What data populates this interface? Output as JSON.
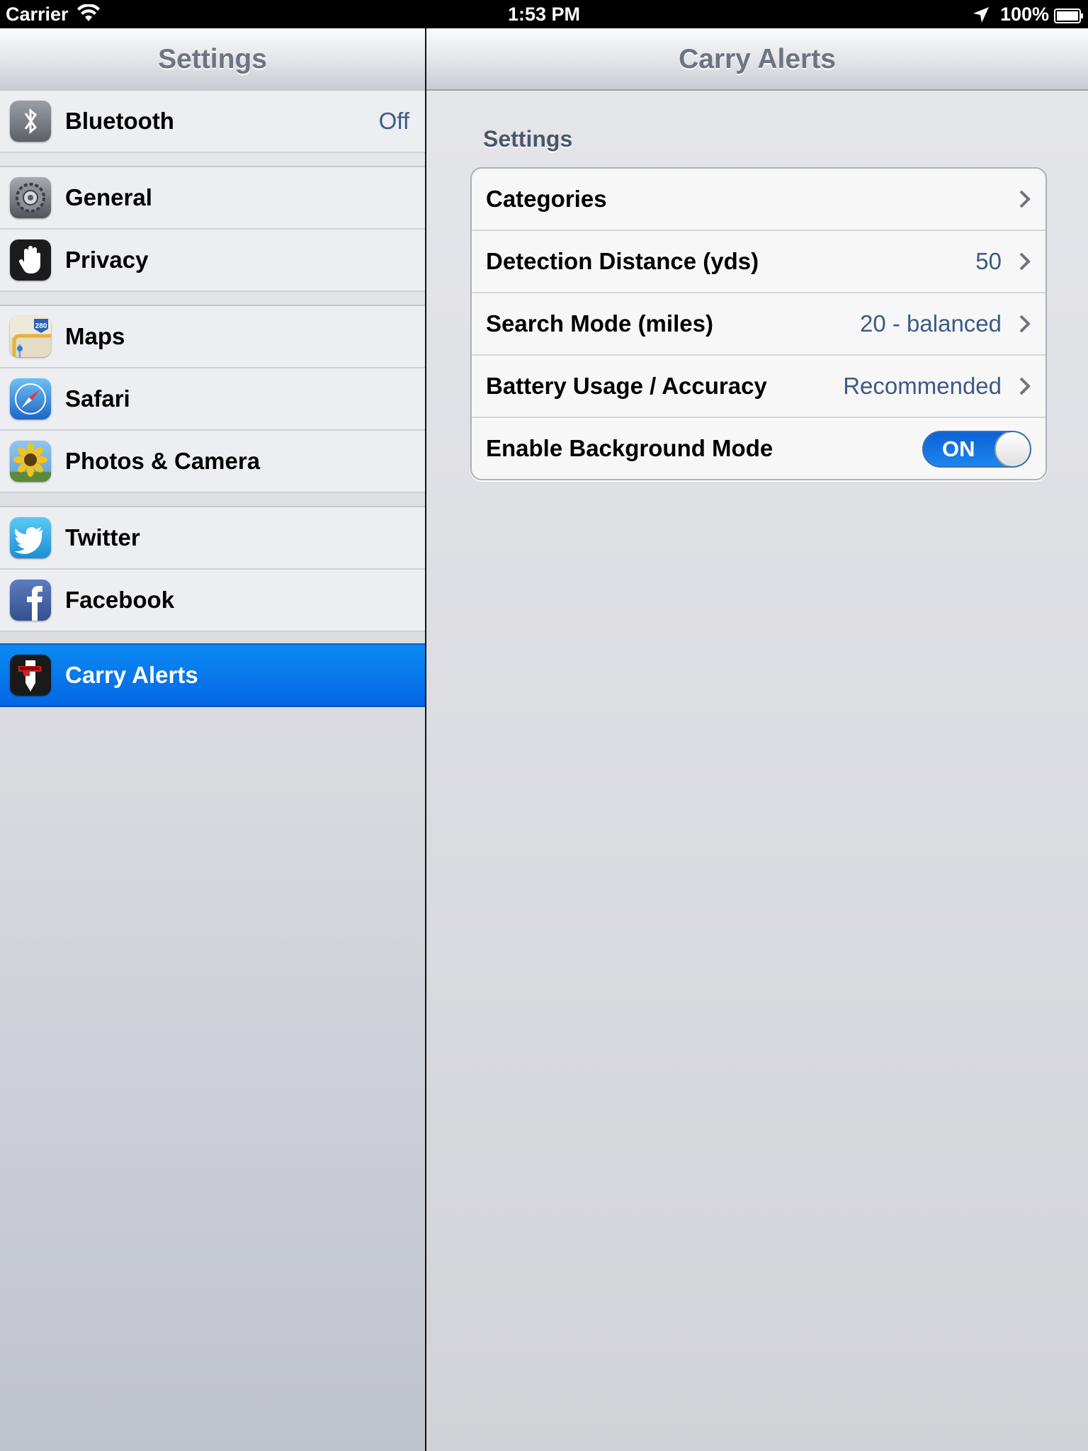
{
  "status_bar": {
    "carrier": "Carrier",
    "time": "1:53 PM",
    "battery": "100%"
  },
  "master": {
    "title": "Settings",
    "groups": [
      [
        {
          "label": "Bluetooth",
          "value": "Off",
          "icon": "bluetooth-icon"
        }
      ],
      [
        {
          "label": "General",
          "icon": "gear-icon"
        },
        {
          "label": "Privacy",
          "icon": "hand-icon"
        }
      ],
      [
        {
          "label": "Maps",
          "icon": "maps-icon"
        },
        {
          "label": "Safari",
          "icon": "compass-icon"
        },
        {
          "label": "Photos & Camera",
          "icon": "sunflower-icon"
        }
      ],
      [
        {
          "label": "Twitter",
          "icon": "twitter-bird-icon"
        },
        {
          "label": "Facebook",
          "icon": "facebook-icon"
        }
      ],
      [
        {
          "label": "Carry Alerts",
          "icon": "carry-alerts-icon",
          "selected": true
        }
      ]
    ]
  },
  "detail": {
    "title": "Carry Alerts",
    "section_header": "Settings",
    "cells": [
      {
        "label": "Categories",
        "value": ""
      },
      {
        "label": "Detection Distance (yds)",
        "value": "50"
      },
      {
        "label": "Search Mode (miles)",
        "value": "20 - balanced"
      },
      {
        "label": "Battery Usage / Accuracy",
        "value": "Recommended"
      },
      {
        "label": "Enable Background Mode",
        "toggle": "ON"
      }
    ]
  },
  "colors": {
    "selection": "#0567e5",
    "detail_value": "#3c5a86",
    "toggle_on": "#1d86ee"
  }
}
